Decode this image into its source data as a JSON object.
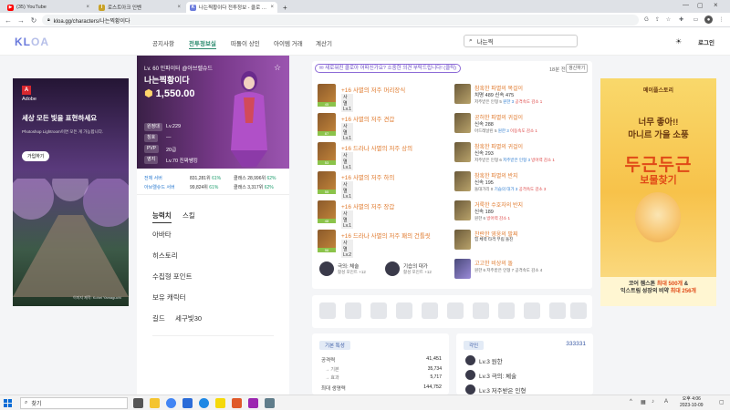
{
  "browser": {
    "tabs": [
      {
        "label": "(35) YouTube",
        "color": "#ff0000",
        "glyph": "▶"
      },
      {
        "label": "로스트아크 인벤",
        "color": "#c9a227",
        "glyph": "I"
      },
      {
        "label": "나는찍황이다 전투정보 - 클로 …",
        "color": "#6b7bdc",
        "glyph": "K"
      }
    ],
    "new_tab": "+",
    "url": "kloa.gg/characters/나는찍황이다"
  },
  "site": {
    "logo_main": "KL",
    "logo_accent": "OA",
    "nav": [
      "공지사항",
      "전투정보실",
      "떠돌이 상인",
      "아이템 거래",
      "계산기"
    ],
    "search_value": "나는찍",
    "login": "로그인"
  },
  "ad_left": {
    "brand": "Adobe",
    "headline": "세상 모든 빛을 표현하세요",
    "sub": "Photoshop Lightroom이면 모든 게 가능합니다.",
    "button": "가입하기",
    "credit": "이미지 제작: Kohei Yamaguchi"
  },
  "profile": {
    "level_line": "Lv. 60 인파이터 @아브렐슈드",
    "name": "나는찍황이다",
    "item_level": "1,550.00",
    "rows": [
      {
        "label": "원정대",
        "value": "Lv.229"
      },
      {
        "label": "칭호",
        "value": "—"
      },
      {
        "label": "PVP",
        "value": "20급"
      },
      {
        "label": "영지",
        "value": "Lv.70 진짜쌩킹"
      }
    ],
    "ranks": [
      {
        "server": "전체 서버",
        "rank": "831,281위",
        "pct": "61%",
        "cls": "클래스 28,996위",
        "cpct": "62%"
      },
      {
        "server": "아브렐슈드 서버",
        "rank": "99,824위",
        "pct": "61%",
        "cls": "클래스 3,317위",
        "cpct": "62%"
      }
    ]
  },
  "left_menu": {
    "tabs": [
      "능력치",
      "스킬"
    ],
    "items": [
      "아바타",
      "히스토리",
      "수집형 포인트",
      "보유 캐릭터"
    ],
    "guild_label": "길드",
    "guild_value": "세구빛30"
  },
  "equipment_panel": {
    "notice": "새로워진 클로아 어떠신가요? 소중한 의견 부탁드립니다! (클릭)",
    "registered": "18분 전",
    "refresh": "갱신하기",
    "gear": [
      {
        "name": "+16 사멸의 저주 머리장식",
        "set": "사멸 Lv.1",
        "q": "45"
      },
      {
        "name": "+16 사멸의 저주 견갑",
        "set": "사멸 Lv.1",
        "q": "87"
      },
      {
        "name": "+16 드라나 사멸의 저주 상의",
        "set": "사멸 Lv.1",
        "q": "53"
      },
      {
        "name": "+16 사멸의 저주 하의",
        "set": "사멸 Lv.1",
        "q": "55"
      },
      {
        "name": "+16 사멸의 저주 장갑",
        "set": "사멸 Lv.1",
        "q": "48"
      },
      {
        "name": "+16 드라나 사멸의 저주 패의 건틀릿",
        "set": "사멸 Lv.2",
        "q": "96"
      }
    ],
    "accessories": [
      {
        "name": "참혹한 파멸의 목걸이",
        "stat": "치명 489  신속 475",
        "opt1": "저주받은 인형 5",
        "opt2": "원한 3",
        "opt3": "공격속도 감소 1",
        "q": "93"
      },
      {
        "name": "공허한 파멸의 귀걸이",
        "stat": "신속 288",
        "opt1": "아드레날린 5",
        "opt2": "원한 3",
        "opt3": "이동속도 감소 1",
        "q": "80"
      },
      {
        "name": "참혹한 파멸의 귀걸이",
        "stat": "신속 293",
        "opt1": "저주받은 인형 6",
        "opt2": "저주받은 인형 3",
        "opt3": "방어력 감소 1",
        "q": "88"
      },
      {
        "name": "참혹한 파멸의 반지",
        "stat": "신속 195",
        "opt1": "돌대가리 0",
        "opt2": "기습의 대가 3",
        "opt3": "공격속도 감소 3",
        "q": "87"
      },
      {
        "name": "거룩한 수호자의 반지",
        "stat": "신속 189",
        "opt1": "원한 6",
        "opt2": "방어력 감소 1",
        "opt3": "",
        "q": "72"
      },
      {
        "name": "찬란한 영웅의 팔찌",
        "stat": "힘  체력  타격  무림  돌진",
        "opt1": "",
        "opt2": "",
        "opt3": "",
        "q": ""
      },
      {
        "name": "고고한 비상의 돌",
        "stat": "원한 6  저주받은 인형 7  공격속도 감소 4",
        "opt1": "",
        "opt2": "",
        "opt3": "",
        "q": ""
      }
    ],
    "engraving_tokens": [
      {
        "name": "극의: 체술",
        "sub": "활성 포인트 +12"
      },
      {
        "name": "기습의 대가",
        "sub": "활성 포인트 +12"
      }
    ]
  },
  "stats": {
    "header": "기본 특성",
    "rows": [
      {
        "label": "공격력",
        "value": "41,451"
      },
      {
        "label": "→ 기본",
        "value": "35,734"
      },
      {
        "label": "→ 효과",
        "value": "5,717"
      },
      {
        "label": "최대 생명력",
        "value": "144,752"
      }
    ]
  },
  "engravings": {
    "header": "각인",
    "code": "333331",
    "items": [
      "Lv.3 원한",
      "Lv.3 극의: 체술",
      "Lv.3 저주받은 인형"
    ]
  },
  "ad_right": {
    "brand": "메이플스토리",
    "line1": "너무 좋아!!",
    "line2": "마니르 가을 소풍",
    "big": "두근두근",
    "big2": "보물찾기",
    "bottom1_a": "코어 젬스톤 ",
    "bottom1_b": "최대 500개",
    "bottom1_c": " &",
    "bottom2_a": "익스트림 성장의 비약 ",
    "bottom2_b": "최대 256개"
  },
  "taskbar": {
    "search_placeholder": "찾기",
    "time": "오후 4:06",
    "date": "2023-10-09"
  }
}
